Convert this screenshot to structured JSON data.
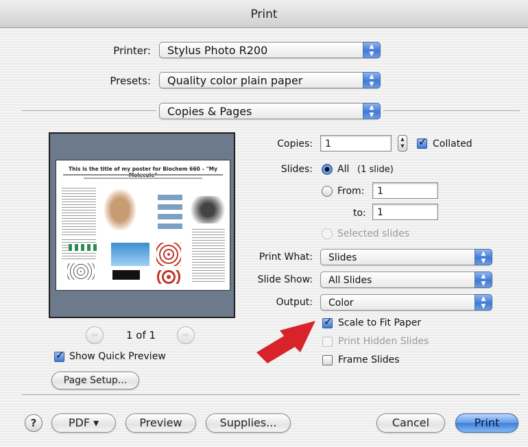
{
  "window": {
    "title": "Print"
  },
  "printer": {
    "label": "Printer:",
    "value": "Stylus Photo R200"
  },
  "presets": {
    "label": "Presets:",
    "value": "Quality color plain paper"
  },
  "panel": {
    "value": "Copies & Pages"
  },
  "preview": {
    "poster_title": "This is the title of my poster for Biochem 660 – \"My Molecule\"",
    "page_indicator": "1 of 1",
    "show_quick_preview": {
      "label": "Show Quick Preview",
      "checked": true
    },
    "page_setup_button": "Page Setup..."
  },
  "copies": {
    "label": "Copies:",
    "value": "1",
    "collated": {
      "label": "Collated",
      "checked": true
    }
  },
  "slides": {
    "label": "Slides:",
    "all_label": "All",
    "all_note": "(1 slide)",
    "from_label": "From:",
    "from_value": "1",
    "to_label": "to:",
    "to_value": "1",
    "selected_label": "Selected slides",
    "selected_option": "All"
  },
  "print_what": {
    "label": "Print What:",
    "value": "Slides"
  },
  "slide_show": {
    "label": "Slide Show:",
    "value": "All Slides"
  },
  "output": {
    "label": "Output:",
    "value": "Color"
  },
  "options": {
    "scale_to_fit": {
      "label": "Scale to Fit Paper",
      "checked": true
    },
    "print_hidden": {
      "label": "Print Hidden Slides",
      "checked": false,
      "enabled": false
    },
    "frame_slides": {
      "label": "Frame Slides",
      "checked": false
    }
  },
  "footer": {
    "help": "?",
    "pdf": "PDF ▾",
    "preview": "Preview",
    "supplies": "Supplies...",
    "cancel": "Cancel",
    "print": "Print"
  },
  "colors": {
    "accent": "#3d78d6",
    "arrow": "#d8232a",
    "preview_bg": "#6d7a8b"
  }
}
